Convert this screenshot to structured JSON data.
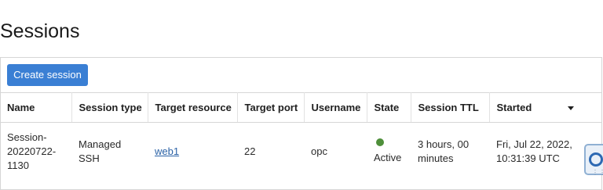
{
  "page": {
    "title": "Sessions"
  },
  "toolbar": {
    "create_label": "Create session"
  },
  "table": {
    "columns": [
      "Name",
      "Session type",
      "Target resource",
      "Target port",
      "Username",
      "State",
      "Session TTL",
      "Started"
    ],
    "rows": [
      {
        "name": "Session-20220722-1130",
        "session_type": "Managed SSH",
        "target_resource": "web1",
        "target_port": "22",
        "username": "opc",
        "state": "Active",
        "session_ttl": "3 hours, 00 minutes",
        "started": "Fri, Jul 22, 2022, 10:31:39 UTC"
      }
    ],
    "sort_icon": "caret-down-icon"
  },
  "colors": {
    "primary_button": "#3a7fd4",
    "link": "#2b62a6",
    "state_active": "#4e8f3a"
  },
  "help_icon": "lifebuoy-icon"
}
